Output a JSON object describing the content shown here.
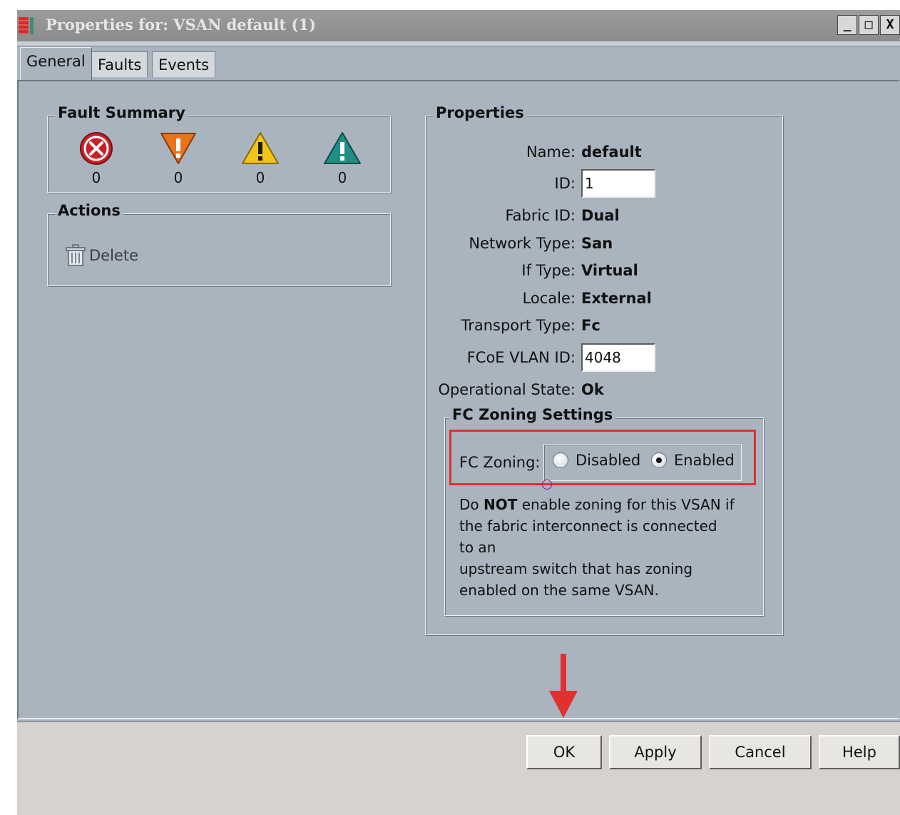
{
  "window": {
    "title": "Properties for: VSAN default (1)",
    "controls": {
      "minimize": "_",
      "maximize": "□",
      "close": "X"
    }
  },
  "tabs": [
    {
      "label": "General",
      "active": true
    },
    {
      "label": "Faults",
      "active": false
    },
    {
      "label": "Events",
      "active": false
    }
  ],
  "fault_summary": {
    "title": "Fault Summary",
    "items": [
      {
        "icon": "critical-fault-icon",
        "count": "0",
        "color": "#c8202a"
      },
      {
        "icon": "major-fault-icon",
        "count": "0",
        "color": "#e8741c"
      },
      {
        "icon": "minor-fault-icon",
        "count": "0",
        "color": "#f0c419"
      },
      {
        "icon": "warning-fault-icon",
        "count": "0",
        "color": "#1f8f86"
      }
    ]
  },
  "actions": {
    "title": "Actions",
    "delete_label": "Delete"
  },
  "properties": {
    "title": "Properties",
    "name_label": "Name:",
    "name_value": "default",
    "id_label": "ID:",
    "id_value": "1",
    "fabric_id_label": "Fabric ID:",
    "fabric_id_value": "Dual",
    "network_type_label": "Network Type:",
    "network_type_value": "San",
    "if_type_label": "If Type:",
    "if_type_value": "Virtual",
    "locale_label": "Locale:",
    "locale_value": "External",
    "transport_type_label": "Transport Type:",
    "transport_type_value": "Fc",
    "fcoe_vlan_id_label": "FCoE VLAN ID:",
    "fcoe_vlan_id_value": "4048",
    "operational_state_label": "Operational State:",
    "operational_state_value": "Ok"
  },
  "fc_zoning": {
    "title": "FC Zoning Settings",
    "label": "FC Zoning:",
    "options": [
      {
        "label": "Disabled",
        "selected": false
      },
      {
        "label": "Enabled",
        "selected": true
      }
    ],
    "note_do": "Do ",
    "note_not": "NOT",
    "note_rest1": " enable zoning for this VSAN if",
    "note_line2": "the fabric interconnect is connected",
    "note_line3": "to an",
    "note_line4": "upstream switch that has zoning",
    "note_line5": "enabled on the same VSAN."
  },
  "buttons": {
    "ok": "OK",
    "apply": "Apply",
    "cancel": "Cancel",
    "help": "Help"
  },
  "colors": {
    "dialog_bg": "#a9b4bf",
    "annotation_red": "#e0302f"
  }
}
